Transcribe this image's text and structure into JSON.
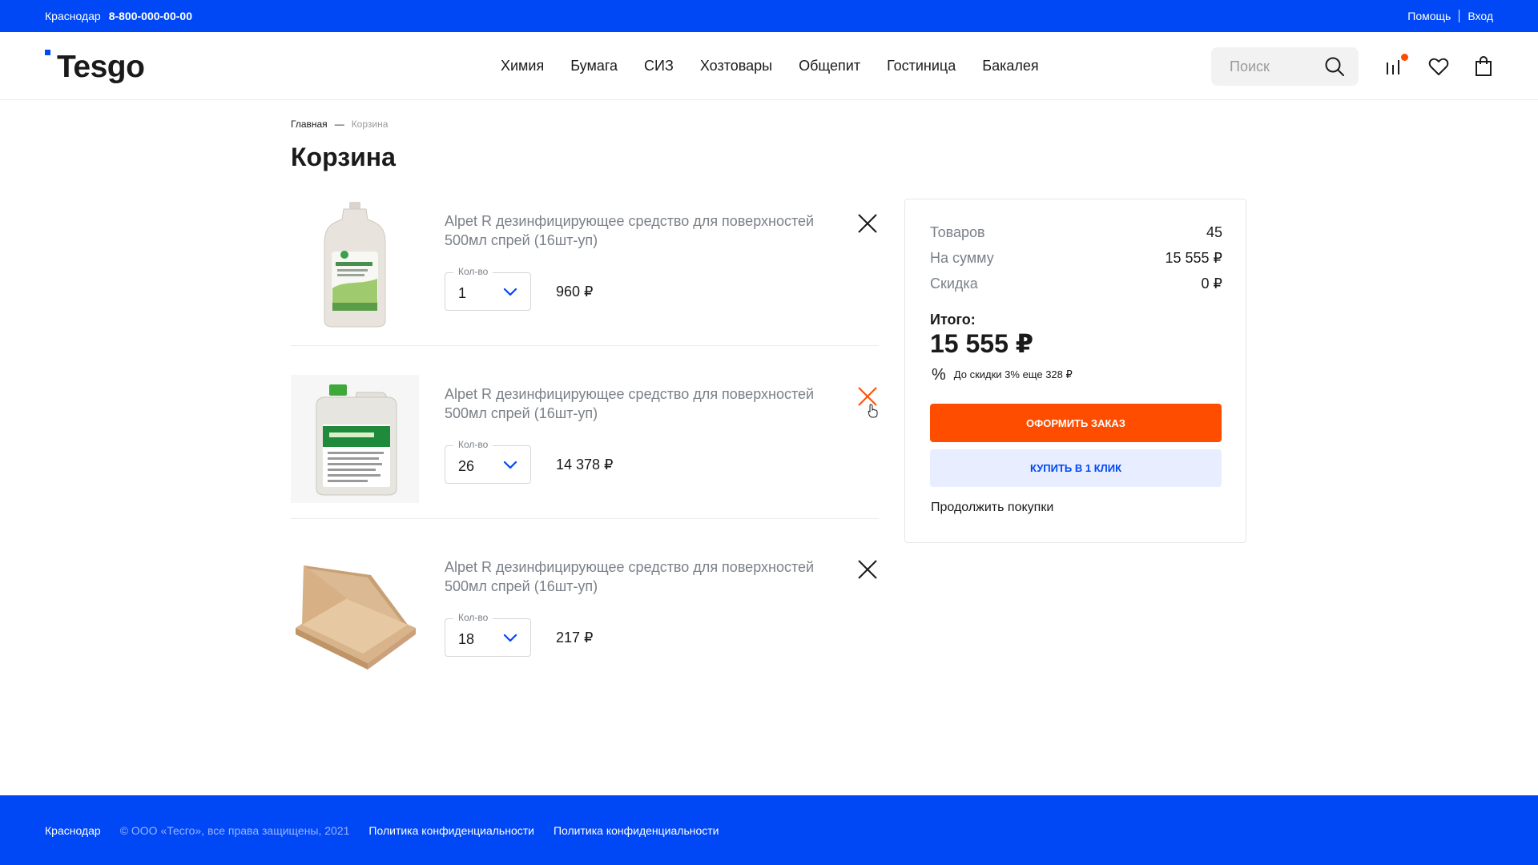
{
  "topbar": {
    "city": "Краснодар",
    "phone": "8-800-000-00-00",
    "help": "Помощь",
    "login": "Вход"
  },
  "header": {
    "logo": "Tesgo",
    "nav": [
      "Химия",
      "Бумага",
      "СИЗ",
      "Хозтовары",
      "Общепит",
      "Гостиница",
      "Бакалея"
    ],
    "search_placeholder": "Поиск",
    "icons": [
      "search-icon",
      "compare-icon",
      "heart-icon",
      "cart-icon"
    ],
    "compare_badge_color": "#ff4d00"
  },
  "breadcrumb": {
    "home": "Главная",
    "separator": "—",
    "current": "Корзина"
  },
  "page_title": "Корзина",
  "cart": {
    "qty_label": "Кол-во",
    "items": [
      {
        "title": "Alpet R дезинфицирующее средство для поверхностей 500мл спрей (16шт-уп)",
        "qty": "1",
        "price": "960 ₽",
        "image": "bottle-icon"
      },
      {
        "title": "Alpet R дезинфицирующее средство для поверхностей 500мл спрей (16шт-уп)",
        "qty": "26",
        "price": "14 378 ₽",
        "image": "canister-icon"
      },
      {
        "title": "Alpet R дезинфицирующее средство для поверхностей 500мл спрей (16шт-уп)",
        "qty": "18",
        "price": "217 ₽",
        "image": "pizza-box-icon"
      }
    ]
  },
  "summary": {
    "goods_label": "Товаров",
    "goods_value": "45",
    "sum_label": "На сумму",
    "sum_value": "15 555 ₽",
    "discount_label": "Скидка",
    "discount_value": "0 ₽",
    "total_label": "Итого:",
    "total_value": "15 555 ₽",
    "discount_note_symbol": "%",
    "discount_note": "До скидки 3% еще 328 ₽",
    "order_button": "ОФОРМИТЬ ЗАКАЗ",
    "oneclick_button": "КУПИТЬ В 1 КЛИК",
    "continue": "Продолжить покупки"
  },
  "footer": {
    "city": "Краснодар",
    "copyright": "© ООО «Тесго», все права защищены, 2021",
    "links": [
      "Политика конфиденциальности",
      "Политика конфиденциальности"
    ]
  },
  "colors": {
    "brand_blue": "#0047f5",
    "accent_orange": "#ff4d00",
    "oneclick_bg": "#e8eeff",
    "muted_text": "#7b8089"
  }
}
